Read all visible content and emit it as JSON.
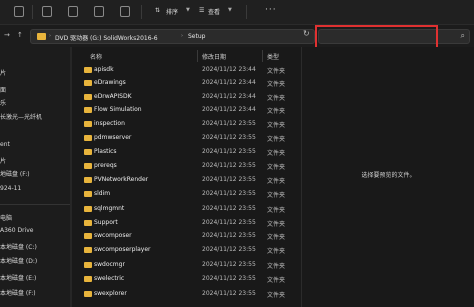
{
  "toolbar": {
    "sort_label": "排序",
    "view_label": "查看",
    "more": "···"
  },
  "address": {
    "crumbs": [
      "DVD 驱动器 (G:) SolidWorks2016-6",
      "Setup"
    ]
  },
  "search": {
    "placeholder": ""
  },
  "sidebar": {
    "items": [
      {
        "label": "面"
      },
      {
        "label": "片"
      },
      {
        "label": "面"
      },
      {
        "label": "乐"
      },
      {
        "label": "长激光—光纤机"
      },
      {
        "label": "ent"
      },
      {
        "label": "片"
      },
      {
        "label": "地磁盘 (F:)"
      },
      {
        "label": "924-11"
      },
      {
        "label": "电脑"
      },
      {
        "label": "A360 Drive"
      },
      {
        "label": "本地磁盘 (C:)"
      },
      {
        "label": "本地磁盘 (D:)"
      },
      {
        "label": "本地磁盘 (E:)"
      },
      {
        "label": "本地磁盘 (F:)"
      }
    ]
  },
  "columns": {
    "name": "名称",
    "date": "修改日期",
    "type": "类型"
  },
  "files": [
    {
      "name": "apisdk",
      "date": "2024/11/12 23:44",
      "type": "文件夹"
    },
    {
      "name": "eDrawings",
      "date": "2024/11/12 23:44",
      "type": "文件夹"
    },
    {
      "name": "eDrwAPISDK",
      "date": "2024/11/12 23:44",
      "type": "文件夹"
    },
    {
      "name": "Flow Simulation",
      "date": "2024/11/12 23:44",
      "type": "文件夹"
    },
    {
      "name": "inspection",
      "date": "2024/11/12 23:55",
      "type": "文件夹"
    },
    {
      "name": "pdmwserver",
      "date": "2024/11/12 23:55",
      "type": "文件夹"
    },
    {
      "name": "Plastics",
      "date": "2024/11/12 23:55",
      "type": "文件夹"
    },
    {
      "name": "prereqs",
      "date": "2024/11/12 23:55",
      "type": "文件夹"
    },
    {
      "name": "PVNetworkRender",
      "date": "2024/11/12 23:55",
      "type": "文件夹"
    },
    {
      "name": "sldim",
      "date": "2024/11/12 23:55",
      "type": "文件夹"
    },
    {
      "name": "sqlmgmnt",
      "date": "2024/11/12 23:55",
      "type": "文件夹"
    },
    {
      "name": "Support",
      "date": "2024/11/12 23:55",
      "type": "文件夹"
    },
    {
      "name": "swcomposer",
      "date": "2024/11/12 23:55",
      "type": "文件夹"
    },
    {
      "name": "swcomposerplayer",
      "date": "2024/11/12 23:55",
      "type": "文件夹"
    },
    {
      "name": "swdocmgr",
      "date": "2024/11/12 23:55",
      "type": "文件夹"
    },
    {
      "name": "swelectric",
      "date": "2024/11/12 23:55",
      "type": "文件夹"
    },
    {
      "name": "swexplorer",
      "date": "2024/11/12 23:55",
      "type": "文件夹"
    }
  ],
  "preview": {
    "message": "选择要预览的文件。"
  }
}
